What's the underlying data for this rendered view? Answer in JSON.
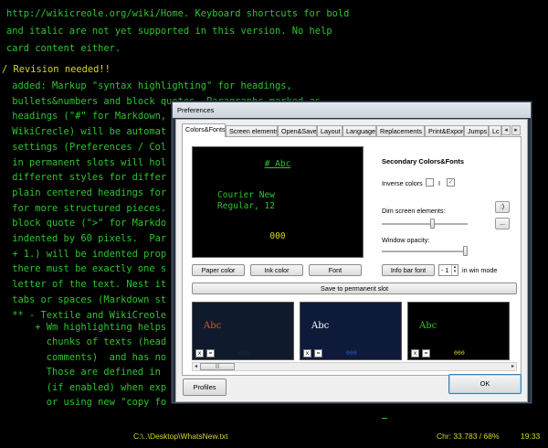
{
  "editor": {
    "lines": [
      {
        "text": "http://wikicreole.org/wiki/Home. Keyboard shortcuts for bold",
        "style": "normal"
      },
      {
        "text": "and italic are not yet supported in this version. No help",
        "style": "normal"
      },
      {
        "text": "card content either.",
        "style": "normal"
      },
      {
        "text": "/ Revision needed!!",
        "style": "highlight"
      },
      {
        "text": " added: Markup \"syntax highlighting\" for headings,",
        "style": "normal"
      },
      {
        "text": " bullets&numbers and block quotes. Paragraphs marked as",
        "style": "normal"
      },
      {
        "text": " headings (\"#\" for Markdown,",
        "style": "normal"
      },
      {
        "text": " WikiCrecle) will be automat",
        "style": "normal"
      },
      {
        "text": " settings (Preferences / Col",
        "style": "normal"
      },
      {
        "text": " in permanent slots will hol",
        "style": "normal"
      },
      {
        "text": " different styles for differ",
        "style": "normal"
      },
      {
        "text": " plain centered headings for",
        "style": "normal"
      },
      {
        "text": " for more structured pieces.",
        "style": "normal"
      },
      {
        "text": " block quote (\">\" for Markdo",
        "style": "normal"
      },
      {
        "text": " indented by 60 pixels.  Par",
        "style": "normal"
      },
      {
        "text": " + 1.) will be indented prop",
        "style": "normal"
      },
      {
        "text": " there must be exactly one s",
        "style": "normal"
      },
      {
        "text": " letter of the text. Nest it",
        "style": "normal"
      },
      {
        "text": " tabs or spaces (Markdown st",
        "style": "normal"
      },
      {
        "text": " ** - Textile and WikiCreole",
        "style": "normal"
      },
      {
        "text": "",
        "style": "normal"
      },
      {
        "text": "     + Wm highlighting helps",
        "style": "normal"
      },
      {
        "text": "       chunks of texts (head",
        "style": "normal"
      },
      {
        "text": "       comments)  and has no",
        "style": "normal"
      },
      {
        "text": "       Those are defined in",
        "style": "normal"
      },
      {
        "text": "       (if enabled) when exp",
        "style": "normal"
      },
      {
        "text": "       or using new \"copy fo",
        "style": "normal"
      }
    ],
    "colors": {
      "text": "#2ec42e",
      "highlight": "#d8d820",
      "background": "#000000"
    }
  },
  "status": {
    "file": "C:\\..\\Desktop\\WhatsNew.txt",
    "chars": "Chr: 33.783 / 68%",
    "time": "19:33"
  },
  "dialog": {
    "title": "Preferences",
    "tabs": [
      "Colors&Fonts",
      "Screen elements",
      "Open&Save",
      "Layout",
      "Language",
      "Replacements",
      "Print&Export",
      "Jumps",
      "Lc"
    ],
    "active_tab": "Colors&Fonts",
    "preview": {
      "heading": "# Abc",
      "font_line1": "Courier New",
      "font_line2": "Regular, 12",
      "number": "000"
    },
    "secondary": {
      "title": "Secondary Colors&Fonts",
      "inverse_label": "Inverse colors",
      "inverse_checked": false,
      "i_label": "I",
      "i_checked": true,
      "dim_label": "Dim screen elements:",
      "dim_level": 0.6,
      "opacity_label": "Window opacity:",
      "opacity_level": 1.0,
      "plus_button": ":)",
      "ellipsis_button": "..."
    },
    "buttons": {
      "paper_color": "Paper color",
      "ink_color": "Ink color",
      "font": "Font",
      "info_bar_font": "Info bar font",
      "spin_value": "- 1",
      "spin_suffix": "in win mode",
      "save_slot": "Save to permanent slot",
      "profiles": "Profiles",
      "ok": "OK"
    },
    "slots": [
      {
        "abc": "Abc",
        "bg": "#0f1b2c",
        "fg": "#e05030",
        "num": "000",
        "num_color": "#1c2a40",
        "x": "x",
        "eq": "="
      },
      {
        "abc": "Abc",
        "bg": "#0e1a3a",
        "fg": "#ffffff",
        "num": "000",
        "num_color": "#2a5ad0",
        "x": "x",
        "eq": "="
      },
      {
        "abc": "Abc",
        "bg": "#000000",
        "fg": "#2ec42e",
        "num": "000",
        "num_color": "#d8d820",
        "x": "x",
        "eq": "="
      }
    ],
    "scrollbar": {
      "left": "◂",
      "right": "▸",
      "grip": "|||"
    }
  }
}
